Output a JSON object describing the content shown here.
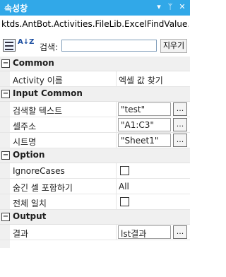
{
  "window": {
    "title": "속성창",
    "dropdown_glyph": "▾",
    "pin_glyph": "ᛘ",
    "close_glyph": "✕"
  },
  "class_name": "ktds.AntBot.Activities.FileLib.ExcelFindValue.Ex...",
  "toolbar": {
    "search_label": "검색:",
    "search_value": "",
    "clear_label": "지우기",
    "sort_icon_text": "A↓Z"
  },
  "categories": [
    {
      "label": "Common",
      "toggle": "−",
      "properties": [
        {
          "name": "Activity 이름",
          "value": "엑셀 값 찾기"
        }
      ]
    },
    {
      "label": "Input Common",
      "toggle": "−",
      "properties": [
        {
          "name": "검색할 텍스트",
          "value": "\"test\"",
          "ellipsis": "..."
        },
        {
          "name": "셀주소",
          "value": "\"A1:C3\"",
          "ellipsis": "..."
        },
        {
          "name": "시트명",
          "value": "\"Sheet1\"",
          "ellipsis": "..."
        }
      ]
    },
    {
      "label": "Option",
      "toggle": "−",
      "properties": [
        {
          "name": "IgnoreCases",
          "checked": false
        },
        {
          "name": "숨긴 셀 포함하기",
          "value": "All"
        },
        {
          "name": "전체 일치",
          "checked": false
        }
      ]
    },
    {
      "label": "Output",
      "toggle": "−",
      "properties": [
        {
          "name": "결과",
          "value": "lst결과",
          "ellipsis": "..."
        }
      ]
    }
  ]
}
